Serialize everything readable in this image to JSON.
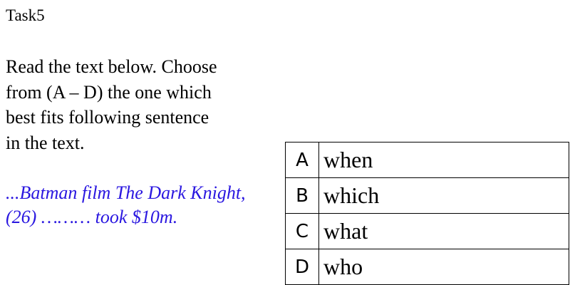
{
  "task": {
    "title": "Task5"
  },
  "instructions": {
    "lines": [
      "Read the text below. Choose",
      "from (A – D) the one which",
      "best fits following sentence",
      "in the text."
    ]
  },
  "excerpt": {
    "lines": [
      "...Batman film The Dark Knight,",
      "(26) ……… took $10m."
    ],
    "color": "#2a17e0"
  },
  "options": [
    {
      "letter": "A",
      "text": "when"
    },
    {
      "letter": "B",
      "text": "which"
    },
    {
      "letter": "C",
      "text": "what"
    },
    {
      "letter": "D",
      "text": "who"
    }
  ]
}
